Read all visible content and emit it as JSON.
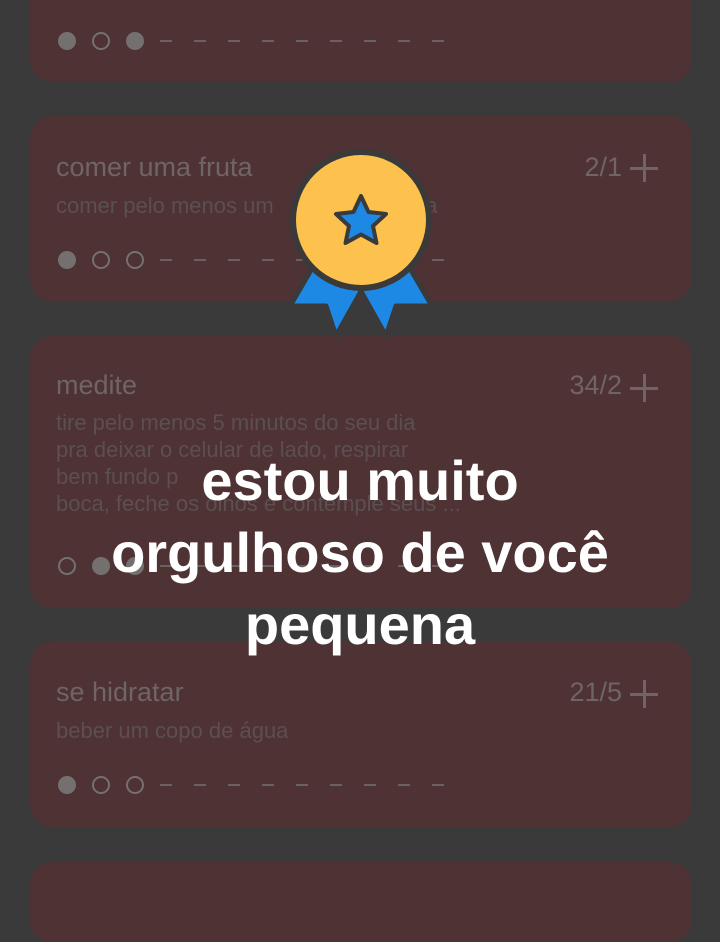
{
  "habits": [
    {
      "title": "",
      "count": "",
      "description": "",
      "dots": [
        "filled",
        "empty",
        "filled"
      ]
    },
    {
      "title": "comer uma fruta",
      "count": "2/1",
      "description": "comer pelo menos um                      dia",
      "dots": [
        "filled",
        "empty",
        "empty"
      ]
    },
    {
      "title": "medite",
      "count": "34/2",
      "description": "tire pelo menos 5 minutos do seu dia\npra deixar o celular de lado, respirar\nbem fundo p                                    \nboca, feche os olhos e contemple seus ...",
      "dots": [
        "empty",
        "filled",
        "filled"
      ]
    },
    {
      "title": "se hidratar",
      "count": "21/5",
      "description": "beber um copo de água",
      "dots": [
        "filled",
        "empty",
        "empty"
      ]
    }
  ],
  "overlay": {
    "line1": "estou muito",
    "line2": "orgulhoso de você",
    "line3": "pequena"
  },
  "badge": {
    "icon": "medal-star-icon",
    "medal_color": "#fcc24d",
    "star_color": "#1e88e5",
    "ribbon_color": "#1e88e5"
  },
  "colors": {
    "background": "#3a3a3a",
    "card": "#4f3233",
    "text_muted": "#6f6466"
  }
}
